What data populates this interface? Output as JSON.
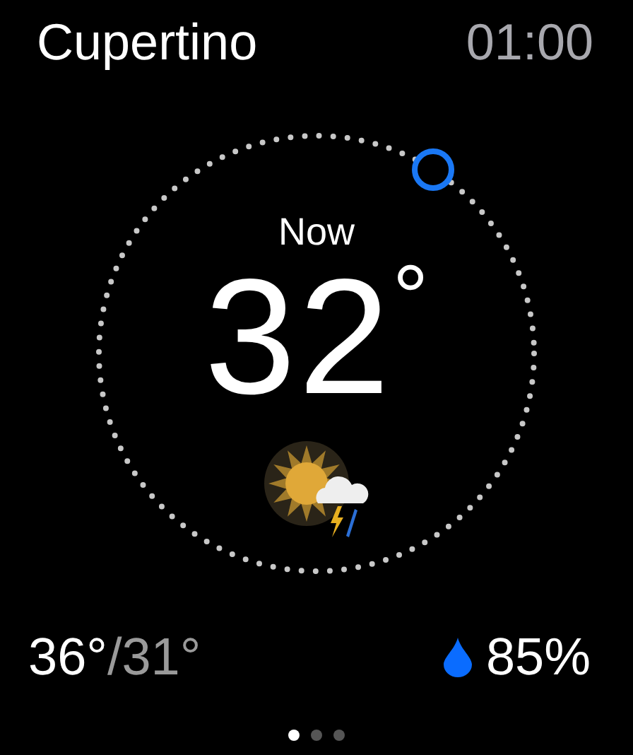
{
  "header": {
    "city": "Cupertino",
    "time": "01:00"
  },
  "dial": {
    "label": "Now",
    "temperature": "32",
    "degree": "°"
  },
  "footer": {
    "high": "36°",
    "low": "/31°",
    "humidity": "85%"
  },
  "pages": [
    {
      "selected": true
    },
    {
      "selected": false
    },
    {
      "selected": false
    }
  ]
}
